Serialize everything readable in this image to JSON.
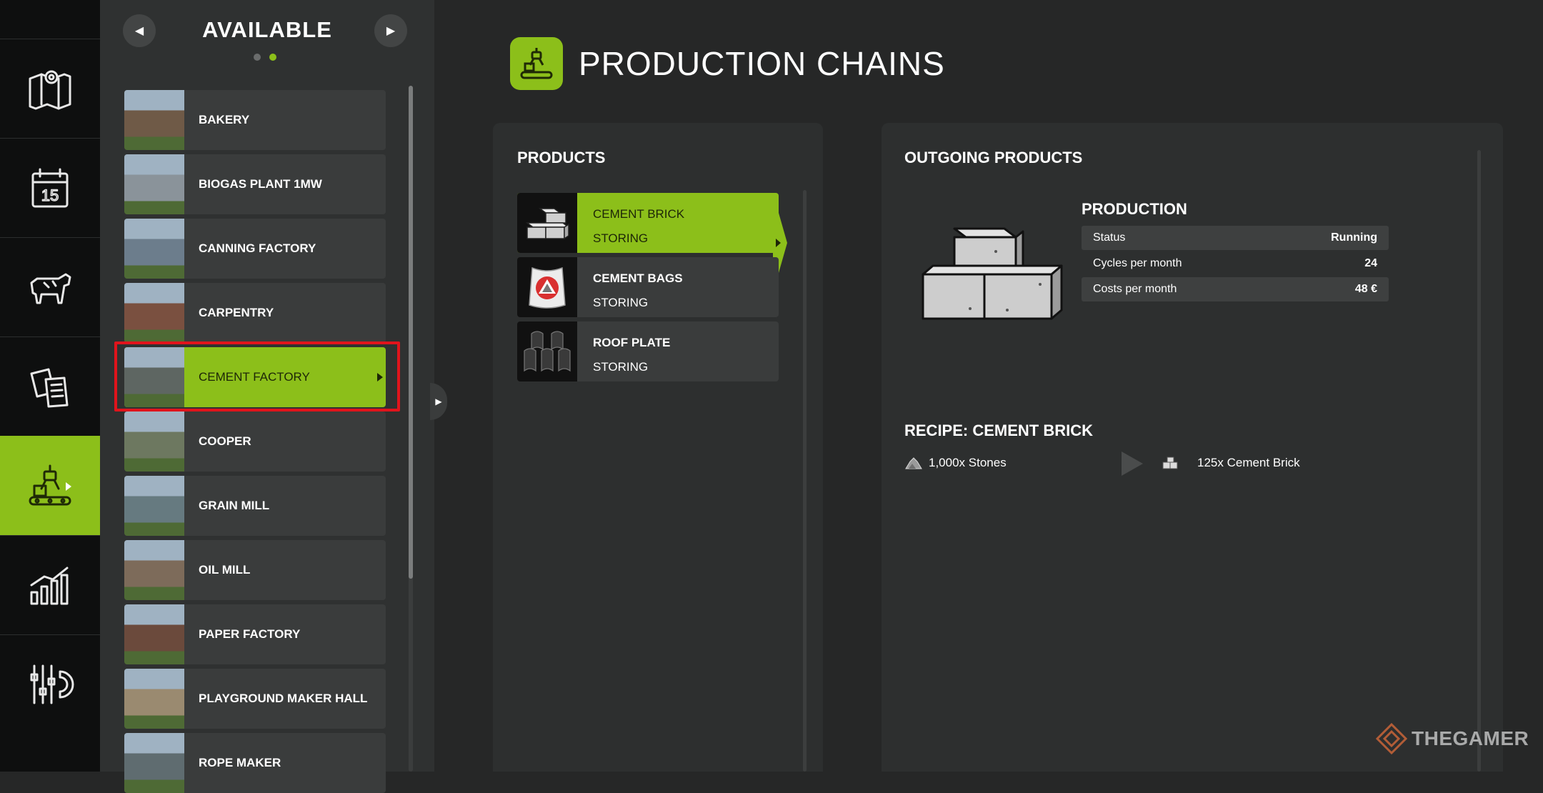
{
  "list_panel": {
    "title": "AVAILABLE",
    "prev_symbol": "◀",
    "next_symbol": "▶",
    "items": [
      {
        "label": "BAKERY",
        "thumb_color": "#6f5a47"
      },
      {
        "label": "BIOGAS PLANT 1MW",
        "thumb_color": "#8a939a"
      },
      {
        "label": "CANNING FACTORY",
        "thumb_color": "#6c7d8c"
      },
      {
        "label": "CARPENTRY",
        "thumb_color": "#7a5040"
      },
      {
        "label": "CEMENT FACTORY",
        "thumb_color": "#5e6662"
      },
      {
        "label": "COOPER",
        "thumb_color": "#6d7860"
      },
      {
        "label": "GRAIN MILL",
        "thumb_color": "#667a80"
      },
      {
        "label": "OIL MILL",
        "thumb_color": "#7d6b5a"
      },
      {
        "label": "PAPER FACTORY",
        "thumb_color": "#6b4a3c"
      },
      {
        "label": "PLAYGROUND MAKER HALL",
        "thumb_color": "#9a8a70"
      },
      {
        "label": "ROPE MAKER",
        "thumb_color": "#5f6c70"
      }
    ],
    "selected_index": 4
  },
  "header": {
    "title": "PRODUCTION CHAINS"
  },
  "products": {
    "title": "PRODUCTS",
    "items": [
      {
        "name": "CEMENT BRICK",
        "state": "STORING"
      },
      {
        "name": "CEMENT BAGS",
        "state": "STORING"
      },
      {
        "name": "ROOF PLATE",
        "state": "STORING"
      }
    ]
  },
  "outgoing": {
    "title": "OUTGOING PRODUCTS",
    "production_title": "PRODUCTION",
    "stats": [
      {
        "key": "Status",
        "value": "Running"
      },
      {
        "key": "Cycles per month",
        "value": "24"
      },
      {
        "key": "Costs per month",
        "value": "48 €"
      }
    ],
    "recipe_title": "RECIPE: CEMENT BRICK",
    "recipe_input": "1,000x Stones",
    "recipe_output": "125x Cement Brick"
  },
  "watermark": {
    "text": "THEGAMER"
  },
  "colors": {
    "accent": "#8cbf1a",
    "highlight": "#e0141c"
  }
}
